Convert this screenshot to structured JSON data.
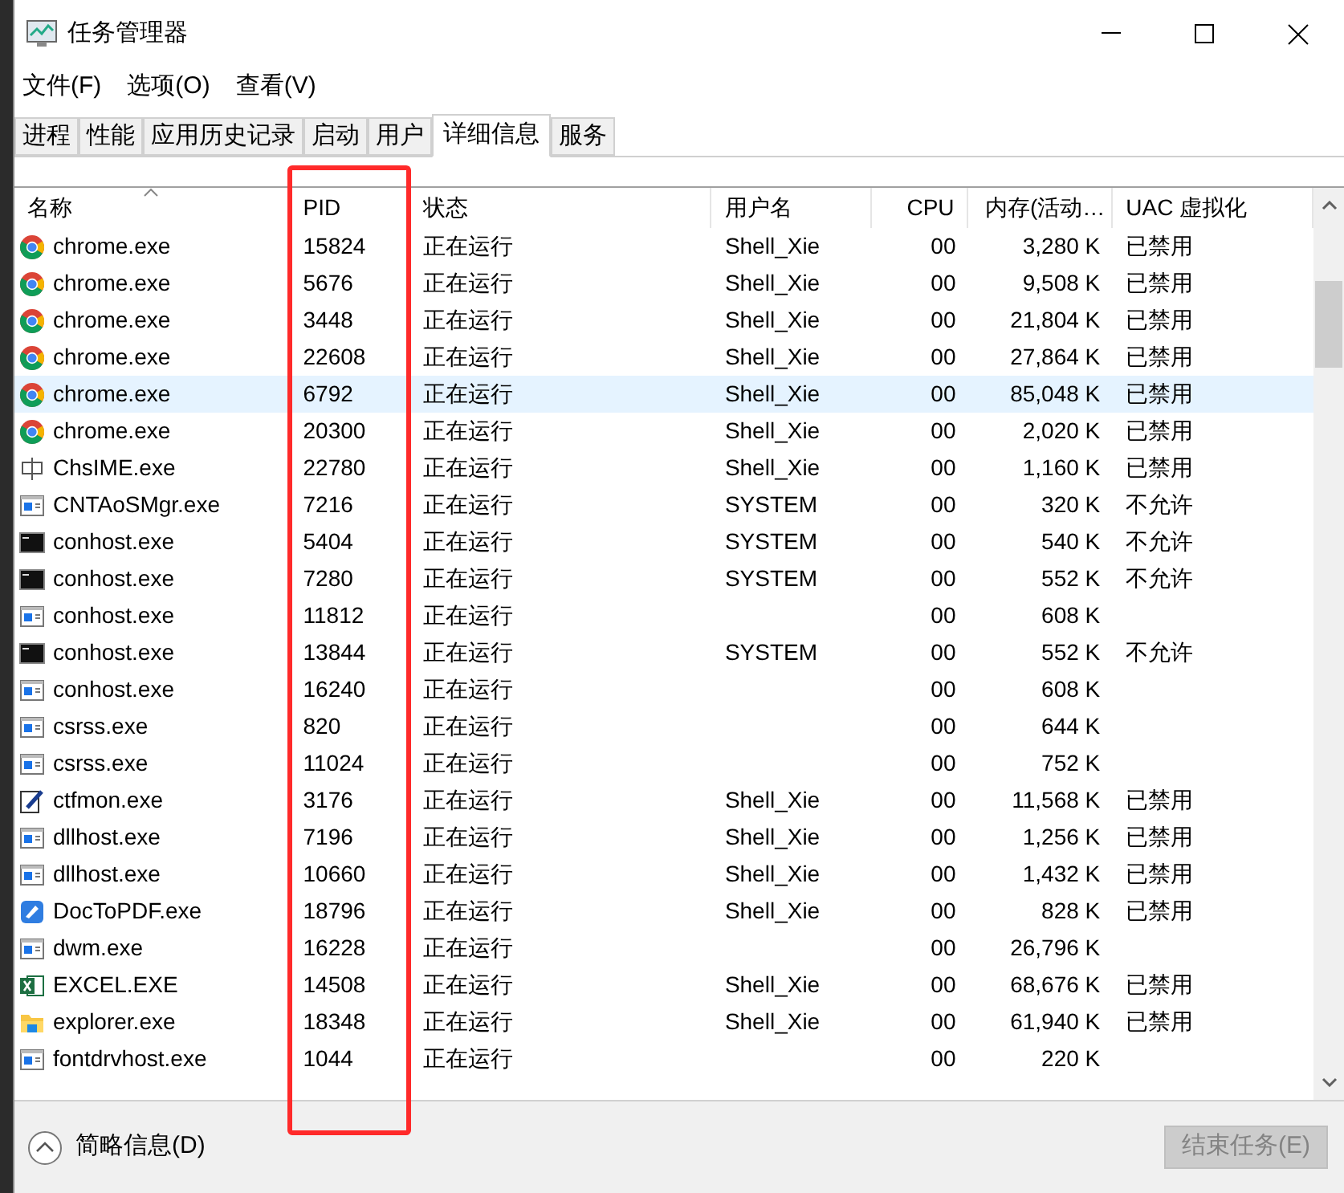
{
  "window": {
    "title": "任务管理器"
  },
  "menu": [
    "文件(F)",
    "选项(O)",
    "查看(V)"
  ],
  "tabs": [
    {
      "label": "进程",
      "selected": false
    },
    {
      "label": "性能",
      "selected": false
    },
    {
      "label": "应用历史记录",
      "selected": false
    },
    {
      "label": "启动",
      "selected": false
    },
    {
      "label": "用户",
      "selected": false
    },
    {
      "label": "详细信息",
      "selected": true
    },
    {
      "label": "服务",
      "selected": false
    }
  ],
  "table": {
    "columns": [
      {
        "label": "名称",
        "sorted": true,
        "highlighted": false
      },
      {
        "label": "PID",
        "sorted": false,
        "highlighted": true
      },
      {
        "label": "状态",
        "sorted": false,
        "highlighted": false
      },
      {
        "label": "用户名",
        "sorted": false,
        "highlighted": false
      },
      {
        "label": "CPU",
        "sorted": false,
        "highlighted": false
      },
      {
        "label": "内存(活动…",
        "sorted": false,
        "highlighted": false
      },
      {
        "label": "UAC 虚拟化",
        "sorted": false,
        "highlighted": false
      }
    ],
    "rows": [
      {
        "kind": "chrome",
        "cells": [
          "chrome.exe",
          "15824",
          "正在运行",
          "Shell_Xie",
          "00",
          "3,280 K",
          "已禁用"
        ],
        "selected": false
      },
      {
        "kind": "chrome",
        "cells": [
          "chrome.exe",
          "5676",
          "正在运行",
          "Shell_Xie",
          "00",
          "9,508 K",
          "已禁用"
        ],
        "selected": false
      },
      {
        "kind": "chrome",
        "cells": [
          "chrome.exe",
          "3448",
          "正在运行",
          "Shell_Xie",
          "00",
          "21,804 K",
          "已禁用"
        ],
        "selected": false
      },
      {
        "kind": "chrome",
        "cells": [
          "chrome.exe",
          "22608",
          "正在运行",
          "Shell_Xie",
          "00",
          "27,864 K",
          "已禁用"
        ],
        "selected": false
      },
      {
        "kind": "chrome",
        "cells": [
          "chrome.exe",
          "6792",
          "正在运行",
          "Shell_Xie",
          "00",
          "85,048 K",
          "已禁用"
        ],
        "selected": true
      },
      {
        "kind": "chrome",
        "cells": [
          "chrome.exe",
          "20300",
          "正在运行",
          "Shell_Xie",
          "00",
          "2,020 K",
          "已禁用"
        ],
        "selected": false
      },
      {
        "kind": "ime",
        "cells": [
          "ChsIME.exe",
          "22780",
          "正在运行",
          "Shell_Xie",
          "00",
          "1,160 K",
          "已禁用"
        ],
        "selected": false
      },
      {
        "kind": "app",
        "cells": [
          "CNTAoSMgr.exe",
          "7216",
          "正在运行",
          "SYSTEM",
          "00",
          "320 K",
          "不允许"
        ],
        "selected": false
      },
      {
        "kind": "console",
        "cells": [
          "conhost.exe",
          "5404",
          "正在运行",
          "SYSTEM",
          "00",
          "540 K",
          "不允许"
        ],
        "selected": false
      },
      {
        "kind": "console",
        "cells": [
          "conhost.exe",
          "7280",
          "正在运行",
          "SYSTEM",
          "00",
          "552 K",
          "不允许"
        ],
        "selected": false
      },
      {
        "kind": "app",
        "cells": [
          "conhost.exe",
          "11812",
          "正在运行",
          "",
          "00",
          "608 K",
          ""
        ],
        "selected": false
      },
      {
        "kind": "console",
        "cells": [
          "conhost.exe",
          "13844",
          "正在运行",
          "SYSTEM",
          "00",
          "552 K",
          "不允许"
        ],
        "selected": false
      },
      {
        "kind": "app",
        "cells": [
          "conhost.exe",
          "16240",
          "正在运行",
          "",
          "00",
          "608 K",
          ""
        ],
        "selected": false
      },
      {
        "kind": "app",
        "cells": [
          "csrss.exe",
          "820",
          "正在运行",
          "",
          "00",
          "644 K",
          ""
        ],
        "selected": false
      },
      {
        "kind": "app",
        "cells": [
          "csrss.exe",
          "11024",
          "正在运行",
          "",
          "00",
          "752 K",
          ""
        ],
        "selected": false
      },
      {
        "kind": "pen",
        "cells": [
          "ctfmon.exe",
          "3176",
          "正在运行",
          "Shell_Xie",
          "00",
          "11,568 K",
          "已禁用"
        ],
        "selected": false
      },
      {
        "kind": "app",
        "cells": [
          "dllhost.exe",
          "7196",
          "正在运行",
          "Shell_Xie",
          "00",
          "1,256 K",
          "已禁用"
        ],
        "selected": false
      },
      {
        "kind": "app",
        "cells": [
          "dllhost.exe",
          "10660",
          "正在运行",
          "Shell_Xie",
          "00",
          "1,432 K",
          "已禁用"
        ],
        "selected": false
      },
      {
        "kind": "doc",
        "cells": [
          "DocToPDF.exe",
          "18796",
          "正在运行",
          "Shell_Xie",
          "00",
          "828 K",
          "已禁用"
        ],
        "selected": false
      },
      {
        "kind": "app",
        "cells": [
          "dwm.exe",
          "16228",
          "正在运行",
          "",
          "00",
          "26,796 K",
          ""
        ],
        "selected": false
      },
      {
        "kind": "excel",
        "cells": [
          "EXCEL.EXE",
          "14508",
          "正在运行",
          "Shell_Xie",
          "00",
          "68,676 K",
          "已禁用"
        ],
        "selected": false
      },
      {
        "kind": "folder",
        "cells": [
          "explorer.exe",
          "18348",
          "正在运行",
          "Shell_Xie",
          "00",
          "61,940 K",
          "已禁用"
        ],
        "selected": false
      },
      {
        "kind": "app",
        "cells": [
          "fontdrvhost.exe",
          "1044",
          "正在运行",
          "",
          "00",
          "220 K",
          ""
        ],
        "selected": false
      }
    ]
  },
  "footer": {
    "toggle": "简略信息(D)",
    "end_task": {
      "label": "结束任务(E)",
      "disabled": true
    }
  }
}
